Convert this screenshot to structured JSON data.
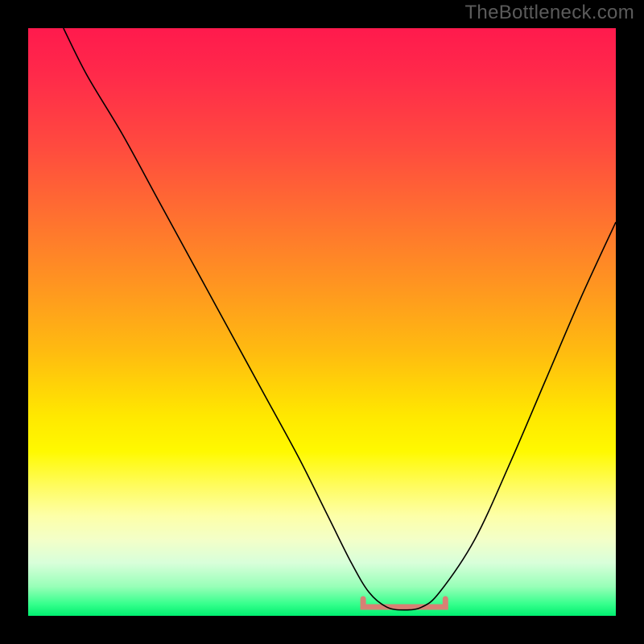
{
  "watermark": "TheBottleneck.com",
  "chart_data": {
    "type": "line",
    "title": "",
    "xlabel": "",
    "ylabel": "",
    "xlim": [
      0,
      100
    ],
    "ylim": [
      0,
      100
    ],
    "grid": false,
    "series": [
      {
        "name": "bottleneck-curve",
        "x": [
          6,
          10,
          16,
          22,
          28,
          34,
          40,
          46,
          51,
          55,
          58,
          61,
          64,
          67,
          70,
          76,
          82,
          88,
          94,
          100
        ],
        "y": [
          100,
          92,
          82,
          71,
          60,
          49,
          38,
          27,
          17,
          9,
          4,
          1.5,
          1,
          1.5,
          4,
          13,
          26,
          40,
          54,
          67
        ]
      }
    ],
    "annotations": [
      {
        "name": "optimal-band",
        "x_range": [
          57,
          71
        ],
        "y": 1.5,
        "color": "#d88074"
      }
    ],
    "background_gradient": {
      "stops": [
        {
          "pos": 0,
          "color": "#ff1a4d"
        },
        {
          "pos": 50,
          "color": "#ffcc00"
        },
        {
          "pos": 80,
          "color": "#ffff80"
        },
        {
          "pos": 100,
          "color": "#00ef70"
        }
      ]
    }
  }
}
